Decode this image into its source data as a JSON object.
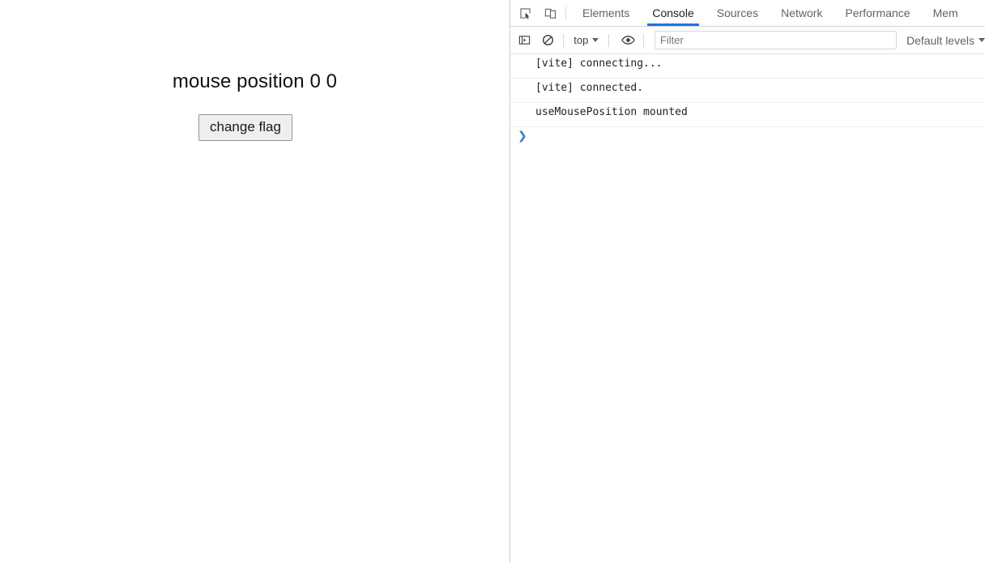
{
  "page": {
    "heading": "mouse position 0 0",
    "button_label": "change flag"
  },
  "devtools": {
    "tabs": [
      {
        "label": "Elements",
        "active": false
      },
      {
        "label": "Console",
        "active": true
      },
      {
        "label": "Sources",
        "active": false
      },
      {
        "label": "Network",
        "active": false
      },
      {
        "label": "Performance",
        "active": false
      },
      {
        "label": "Mem",
        "active": false
      }
    ],
    "icons": {
      "inspect": "inspect-element-icon",
      "device": "device-toolbar-icon",
      "sidebar": "console-sidebar-icon",
      "clear": "clear-console-icon",
      "eye": "live-expression-eye-icon"
    },
    "toolbar": {
      "context_label": "top",
      "filter_placeholder": "Filter",
      "filter_value": "",
      "levels_label": "Default levels"
    },
    "console": {
      "messages": [
        "[vite] connecting...",
        "[vite] connected.",
        "useMousePosition mounted"
      ],
      "prompt_symbol": "❯"
    }
  },
  "colors": {
    "accent": "#1a73e8",
    "prompt": "#4273c8",
    "text": "#202124",
    "muted": "#5f6368"
  }
}
